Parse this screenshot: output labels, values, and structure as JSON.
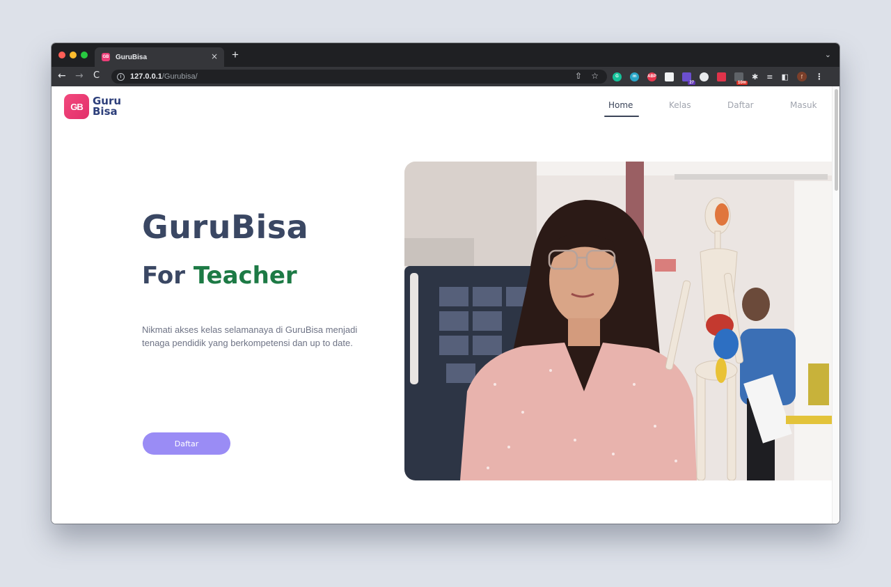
{
  "browser": {
    "tab_title": "GuruBisa",
    "tab_favicon_text": "GB",
    "tab_close": "×",
    "new_tab": "+",
    "tabs_menu": "⌄",
    "url_host": "127.0.0.1",
    "url_path": "/Gurubisa/",
    "extensions": [
      {
        "name": "grammarly-icon",
        "text": "G",
        "color": "#15c39a"
      },
      {
        "name": "m-extension-icon",
        "text": "m",
        "color": "#2aa5c8"
      },
      {
        "name": "adblock-plus-icon",
        "text": "ABP",
        "color": "#e8384f"
      },
      {
        "name": "notes-extension-icon",
        "text": "",
        "color": "#f1f3f4"
      },
      {
        "name": "purple-extension-icon",
        "text": "",
        "color": "#6b4fcf",
        "badge": "27"
      },
      {
        "name": "globe-extension-icon",
        "text": "",
        "color": "#e8eaed"
      },
      {
        "name": "red-extension-icon",
        "text": "",
        "color": "#e0334a"
      },
      {
        "name": "timer-extension-icon",
        "text": "",
        "color": "#5f6368",
        "badge": "10m"
      }
    ],
    "profile_initial": "f"
  },
  "brand": {
    "badge": "GB",
    "line1": "Guru",
    "line2": "Bisa"
  },
  "nav": {
    "home": "Home",
    "kelas": "Kelas",
    "daftar": "Daftar",
    "masuk": "Masuk",
    "active": "Home"
  },
  "hero": {
    "title": "GuruBisa",
    "subtitle_prefix": "For",
    "subtitle_accent": "Teacher",
    "description": "Nikmati akses kelas selamanaya di GuruBisa menjadi tenaga pendidik yang berkompetensi dan up to date.",
    "cta_label": "Daftar"
  },
  "colors": {
    "accent_green": "#1d7a45",
    "button_purple": "#9a8cf5",
    "brand_pink": "#ec3e78",
    "heading": "#3a4763"
  }
}
